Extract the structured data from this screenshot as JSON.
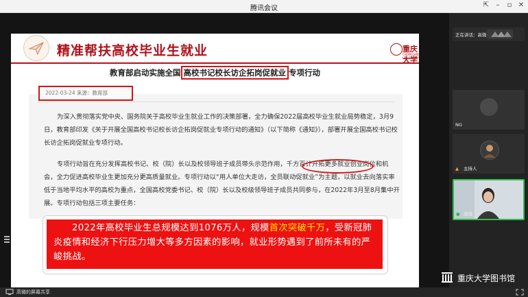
{
  "window": {
    "title": "腾讯会议"
  },
  "slide": {
    "title": "精准帮扶高校毕业生就业",
    "university": "重庆大学",
    "university_en": "CHONGQING UNIVERSITY",
    "article": {
      "headline_pre": "教育部启动实施全国",
      "headline_mark": "高校书记校长访企拓岗促就业",
      "headline_post": "专项行动",
      "meta": "2022-03-24   来源：教育部",
      "paragraph1": "为深入贯彻落实党中央、国务院关于高校毕业生就业工作的决策部署，全力确保2022届高校毕业生就业局势稳定，3月9日，教育部印发《关于开展全国高校书记校长访企拓岗促就业专项行动的通知》（以下简称《通知》），部署开展全国高校书记校长访企拓岗促就业专项行动。",
      "paragraph2": "专项行动旨在充分发挥高校书记、校（院）长以及校领导班子成员带头示范作用，千方百计开拓更多就业创业岗位和机会，全力促进高校毕业生更加充分更高质量就业。专项行动以“用人单位大走访，全员联动促就业”为主题，以就业去向落实率低于当地平均水平的高校为重点，全国高校党委书记、校（院）长以及校级领导班子成员共同参与，在2022年3月至8月集中开展。专项行动包括三项主要任务："
    },
    "callout": {
      "part1": "2022年高校毕业生总规模达到1076万人，规模",
      "highlight": "首次突破千万",
      "part2": "，受新冠肺炎疫情和经济下行压力增大等多方因素的影响，就业形势遇到了前所未有的严峻挑战。"
    }
  },
  "sidebar": {
    "speaking_label": "正在讲话：高微;",
    "participants": [
      {
        "name": "NG",
        "role": ""
      },
      {
        "name": "主持人",
        "role": "host"
      },
      {
        "name": "高微",
        "role": "camera"
      }
    ]
  },
  "watermark": {
    "text": "重庆大学图书馆"
  },
  "share_bar": {
    "text": "高微的屏幕共享"
  },
  "colors": {
    "accent_red": "#b0121b",
    "callout_red": "#ee1111",
    "highlight_yellow": "#ffe600",
    "active_green": "#2fbf4d"
  }
}
